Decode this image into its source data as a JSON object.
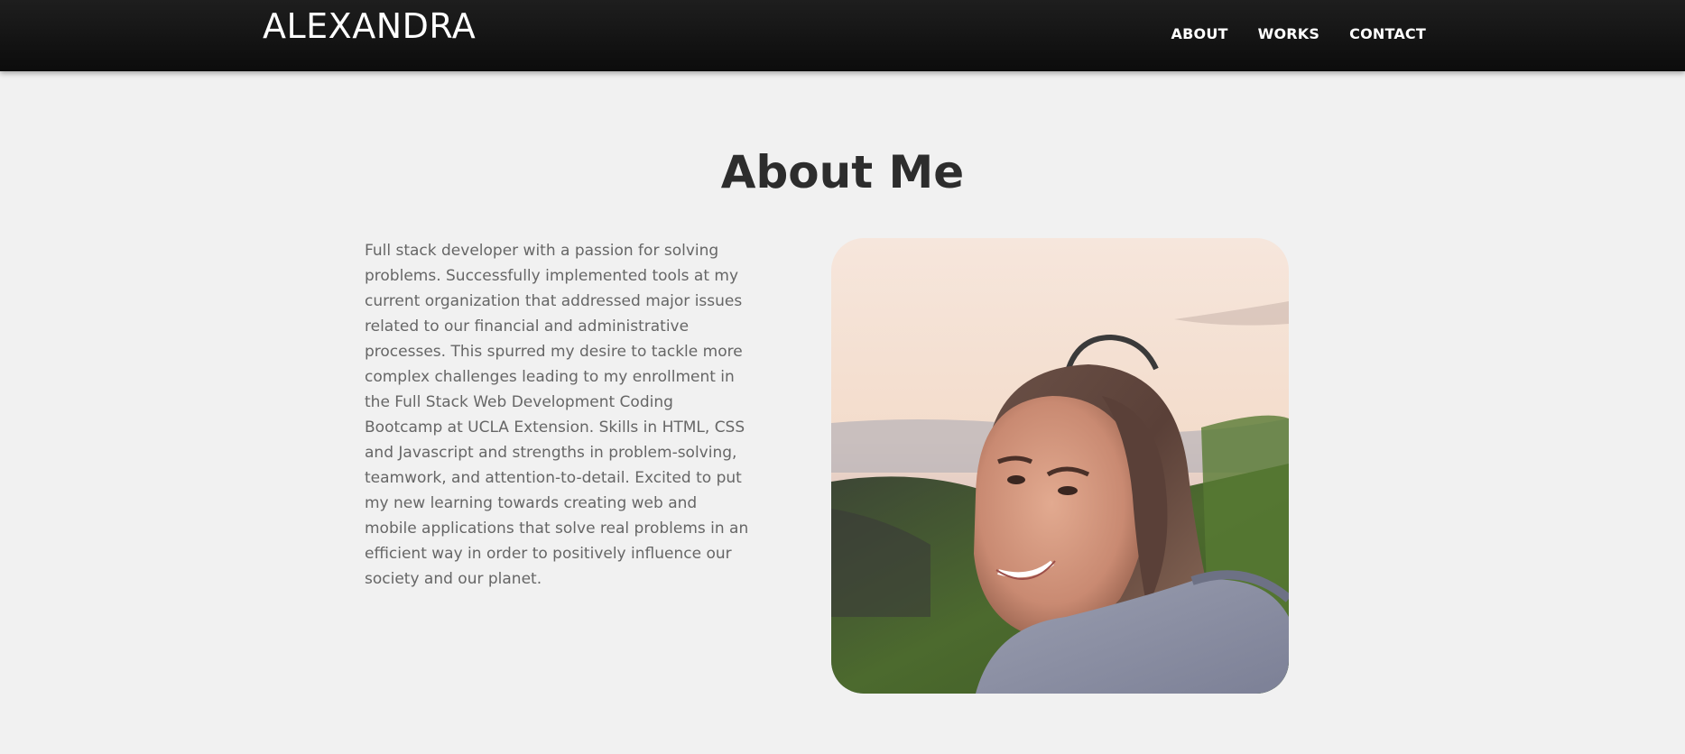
{
  "header": {
    "brand": "ALEXANDRA",
    "nav": [
      {
        "label": "ABOUT"
      },
      {
        "label": "WORKS"
      },
      {
        "label": "CONTACT"
      }
    ]
  },
  "about": {
    "title": "About Me",
    "body": "Full stack developer with a passion for solving problems. Successfully implemented tools at my current organization that addressed major issues related to our financial and administrative processes. This spurred my desire to tackle more complex challenges leading to my enrollment in the Full Stack Web Development Coding Bootcamp at UCLA Extension. Skills in HTML, CSS and Javascript and strengths in problem-solving, teamwork, and attention-to-detail. Excited to put my new learning towards creating web and mobile applications that solve real problems in an efficient way in order to positively influence our society and our planet."
  },
  "colors": {
    "header_bg": "#121212",
    "page_bg": "#f1f1f1",
    "heading": "#2d2d2d",
    "body_text": "#666666"
  }
}
